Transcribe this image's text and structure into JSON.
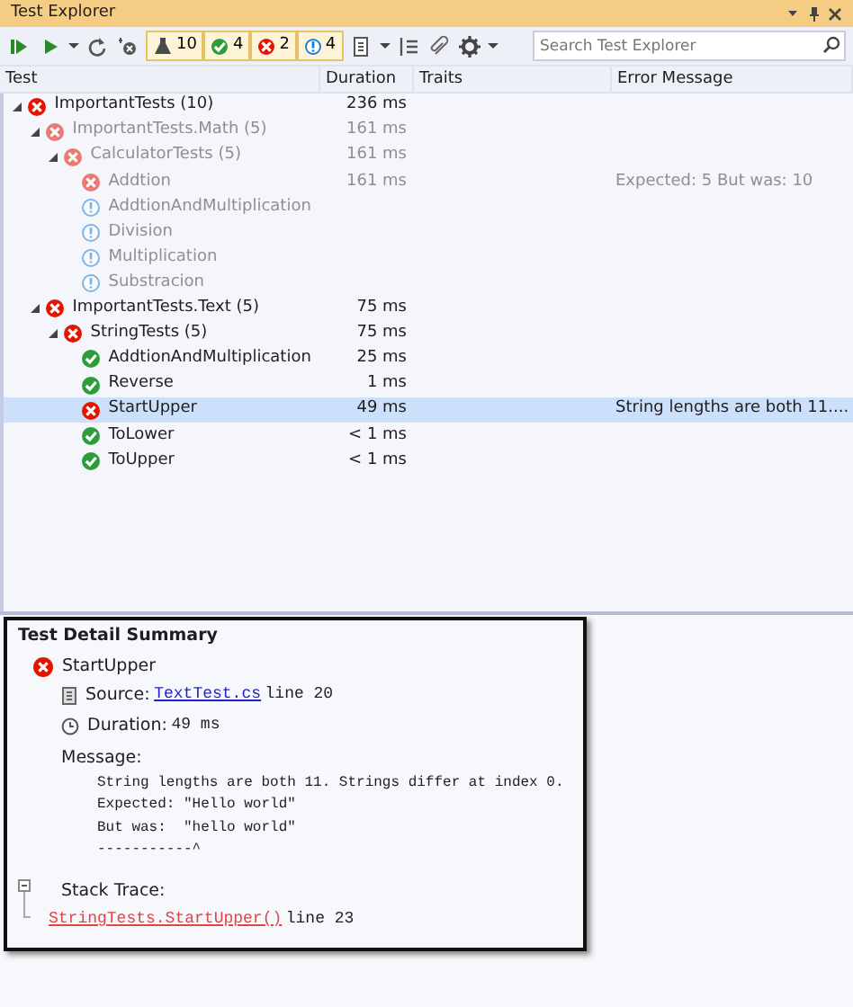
{
  "window": {
    "title": "Test Explorer"
  },
  "toolbar": {
    "filters": [
      {
        "kind": "total",
        "count": "10",
        "on": true
      },
      {
        "kind": "passed",
        "count": "4",
        "on": true
      },
      {
        "kind": "failed",
        "count": "2",
        "on": true
      },
      {
        "kind": "notrun",
        "count": "4",
        "on": true
      }
    ]
  },
  "search": {
    "placeholder": "Search Test Explorer"
  },
  "columns": [
    "Test",
    "Duration",
    "Traits",
    "Error Message"
  ],
  "tests": [
    {
      "name": "ImportantTests  (10)",
      "kind": "failed",
      "stale": false,
      "duration": "236 ms",
      "selected": false,
      "expanded": true,
      "children": [
        {
          "name": "ImportantTests.Math  (5)",
          "kind": "failed",
          "stale": true,
          "duration": "161 ms",
          "selected": false,
          "expanded": true,
          "children": [
            {
              "name": "CalculatorTests  (5)",
              "kind": "failed",
              "stale": true,
              "duration": "161 ms",
              "selected": false,
              "expanded": true,
              "children": [
                {
                  "name": "Addtion",
                  "kind": "failed",
                  "stale": true,
                  "duration": "161 ms",
                  "error": "Expected: 5   But was:  10",
                  "selected": false
                },
                {
                  "name": "AddtionAndMultiplication",
                  "kind": "notrun",
                  "stale": true,
                  "selected": false
                },
                {
                  "name": "Division",
                  "kind": "notrun",
                  "stale": true,
                  "selected": false
                },
                {
                  "name": "Multiplication",
                  "kind": "notrun",
                  "stale": true,
                  "selected": false
                },
                {
                  "name": "Substracion",
                  "kind": "notrun",
                  "stale": true,
                  "selected": false
                }
              ]
            }
          ]
        },
        {
          "name": "ImportantTests.Text  (5)",
          "kind": "failed",
          "stale": false,
          "duration": "75 ms",
          "selected": false,
          "expanded": true,
          "children": [
            {
              "name": "StringTests  (5)",
              "kind": "failed",
              "stale": false,
              "duration": "75 ms",
              "selected": false,
              "expanded": true,
              "children": [
                {
                  "name": "AddtionAndMultiplication",
                  "kind": "passed",
                  "stale": false,
                  "duration": "25 ms",
                  "selected": false
                },
                {
                  "name": "Reverse",
                  "kind": "passed",
                  "stale": false,
                  "duration": "1 ms",
                  "selected": false
                },
                {
                  "name": "StartUpper",
                  "kind": "failed",
                  "stale": false,
                  "duration": "49 ms",
                  "error": "String lengths are both 11....",
                  "selected": true
                },
                {
                  "name": "ToLower",
                  "kind": "passed",
                  "stale": false,
                  "duration": "< 1 ms",
                  "selected": false
                },
                {
                  "name": "ToUpper",
                  "kind": "passed",
                  "stale": false,
                  "duration": "< 1 ms",
                  "selected": false
                }
              ]
            }
          ]
        }
      ]
    }
  ],
  "summary": {
    "title": "Test Detail Summary",
    "test": {
      "name": "StartUpper",
      "kind": "failed"
    },
    "source": {
      "label": "Source:",
      "file": "TextTest.cs",
      "line": "line 20"
    },
    "duration": {
      "label": "Duration:",
      "value": "49 ms"
    },
    "message": {
      "label": "Message:",
      "lines": [
        "String lengths are both 11. Strings differ at index 0.",
        "Expected: \"Hello world\"",
        "But was:  \"hello world\"",
        "-----------^"
      ]
    },
    "stack_trace": {
      "label": "Stack Trace:",
      "expanded": true,
      "frames": [
        {
          "method": "StringTests.StartUpper()",
          "line": "line 23"
        }
      ]
    }
  }
}
